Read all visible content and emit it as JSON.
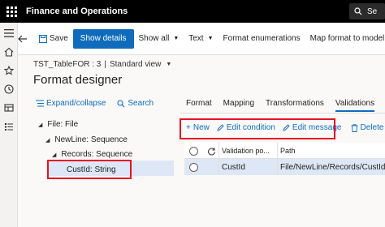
{
  "topbar": {
    "app_title": "Finance and Operations",
    "search_label": "Se"
  },
  "actions": {
    "save": "Save",
    "show_details": "Show details",
    "show_all": "Show all",
    "text": "Text",
    "format_enumerations": "Format enumerations",
    "map_format_to_model": "Map format to model"
  },
  "breadcrumb": {
    "record": "TST_TableFOR : 3",
    "separator": "|",
    "view": "Standard view"
  },
  "page_title": "Format designer",
  "tree_tools": {
    "expand_collapse": "Expand/collapse",
    "search": "Search"
  },
  "tree": {
    "file": "File: File",
    "newline": "NewLine: Sequence",
    "records": "Records: Sequence",
    "custid": "CustId: String"
  },
  "tabs": [
    "Format",
    "Mapping",
    "Transformations",
    "Validations"
  ],
  "active_tab": "Validations",
  "grid_actions": {
    "new": "New",
    "edit_condition": "Edit condition",
    "edit_message": "Edit message",
    "delete": "Delete"
  },
  "grid": {
    "columns": [
      "Validation po...",
      "Path"
    ],
    "rows": [
      {
        "validation_point": "CustId",
        "path": "File/NewLine/Records/CustId"
      }
    ]
  },
  "colors": {
    "accent": "#0f6cbd",
    "highlight_box": "#e81123",
    "selection": "#dde7f5"
  }
}
